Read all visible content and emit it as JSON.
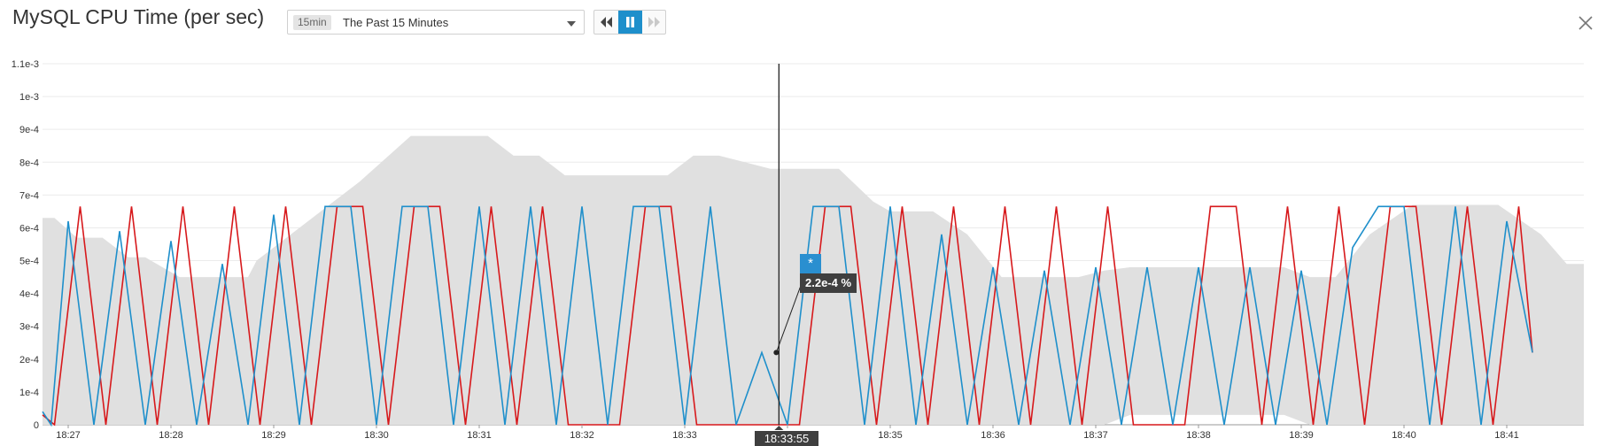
{
  "header": {
    "title": "MySQL CPU Time (per sec)",
    "timeframe_badge": "15min",
    "timeframe_label": "The Past 15 Minutes"
  },
  "controls": {
    "back_icon": "rewind-icon",
    "pause_icon": "pause-icon",
    "forward_icon": "fast-forward-icon",
    "close_icon": "close-icon"
  },
  "colors": {
    "line_primary": "#1e8fcb",
    "line_red": "#d7191c",
    "band": "#e0e0e0",
    "accent": "#1e8fcb"
  },
  "hover": {
    "time": "18:33:55",
    "marker": "*",
    "value_label": "2.2e-4 %"
  },
  "chart_data": {
    "type": "line",
    "title": "MySQL CPU Time (per sec)",
    "xlabel": "",
    "ylabel": "",
    "x_domain": [
      "18:26:45",
      "18:41:45"
    ],
    "ylim": [
      0,
      0.0011
    ],
    "y_ticks": [
      0,
      0.0001,
      0.0002,
      0.0003,
      0.0004,
      0.0005,
      0.0006,
      0.0007,
      0.0008,
      0.0009,
      0.001,
      0.0011
    ],
    "y_tick_labels": [
      "0",
      "1e-4",
      "2e-4",
      "3e-4",
      "4e-4",
      "5e-4",
      "6e-4",
      "7e-4",
      "8e-4",
      "9e-4",
      "1e-3",
      "1.1e-3"
    ],
    "x_ticks": [
      "18:27",
      "18:28",
      "18:29",
      "18:30",
      "18:31",
      "18:32",
      "18:33",
      "18:34",
      "18:35",
      "18:36",
      "18:37",
      "18:38",
      "18:39",
      "18:40",
      "18:41"
    ],
    "x_tick_labels": [
      "18:27",
      "18:28",
      "18:29",
      "18:30",
      "18:31",
      "18:32",
      "18:33",
      "",
      "18:35",
      "18:36",
      "18:37",
      "18:38",
      "18:39",
      "18:40",
      "18:41"
    ],
    "grid": "horizontal",
    "band": {
      "x": [
        "18:26:45",
        "18:26:52",
        "18:27:05",
        "18:27:20",
        "18:27:35",
        "18:27:45",
        "18:28:05",
        "18:28:10",
        "18:28:45",
        "18:28:50",
        "18:29:20",
        "18:29:50",
        "18:30:20",
        "18:30:50",
        "18:31:05",
        "18:31:20",
        "18:31:35",
        "18:31:50",
        "18:32:50",
        "18:33:05",
        "18:33:20",
        "18:33:35",
        "18:33:50",
        "18:34:30",
        "18:34:50",
        "18:35:00",
        "18:35:25",
        "18:35:45",
        "18:36:05",
        "18:36:35",
        "18:36:50",
        "18:37:05",
        "18:37:20",
        "18:37:50",
        "18:38:10",
        "18:38:50",
        "18:39:05",
        "18:39:20",
        "18:39:40",
        "18:40:05",
        "18:40:40",
        "18:40:55",
        "18:41:20",
        "18:41:35",
        "18:41:45"
      ],
      "upper": [
        0.00063,
        0.00063,
        0.00057,
        0.00057,
        0.00051,
        0.00051,
        0.00045,
        0.00045,
        0.00045,
        0.0005,
        0.00062,
        0.00074,
        0.00088,
        0.00088,
        0.00088,
        0.00082,
        0.00082,
        0.00076,
        0.00076,
        0.00082,
        0.00082,
        0.0008,
        0.00078,
        0.00078,
        0.00068,
        0.00065,
        0.00065,
        0.00058,
        0.00045,
        0.00045,
        0.00045,
        0.00047,
        0.00048,
        0.00048,
        0.00048,
        0.00048,
        0.00045,
        0.00045,
        0.00058,
        0.00067,
        0.00067,
        0.00067,
        0.00058,
        0.00049,
        0.00049
      ],
      "lower": [
        0,
        0,
        0,
        0,
        0,
        0,
        0,
        0,
        0,
        0,
        0,
        0,
        0,
        0,
        0,
        0,
        0,
        0,
        0,
        0,
        0,
        0,
        0,
        0,
        0,
        0,
        0,
        0,
        0,
        0,
        0,
        0,
        3e-05,
        3e-05,
        3e-05,
        3e-05,
        0,
        0,
        0,
        0,
        0,
        0,
        0,
        0,
        0
      ]
    },
    "series": [
      {
        "color": "#1e8fcb",
        "x": [
          "18:26:45",
          "18:26:50",
          "18:27:00",
          "18:27:15",
          "18:27:30",
          "18:27:45",
          "18:28:00",
          "18:28:15",
          "18:28:30",
          "18:28:45",
          "18:29:00",
          "18:29:15",
          "18:29:30",
          "18:29:45",
          "18:30:00",
          "18:30:15",
          "18:30:30",
          "18:30:45",
          "18:31:00",
          "18:31:15",
          "18:31:30",
          "18:31:45",
          "18:32:00",
          "18:32:15",
          "18:32:30",
          "18:32:45",
          "18:33:00",
          "18:33:15",
          "18:33:30",
          "18:33:45",
          "18:34:00",
          "18:34:15",
          "18:34:30",
          "18:34:45",
          "18:35:00",
          "18:35:15",
          "18:35:30",
          "18:35:45",
          "18:36:00",
          "18:36:15",
          "18:36:30",
          "18:36:45",
          "18:37:00",
          "18:37:15",
          "18:37:30",
          "18:37:45",
          "18:38:00",
          "18:38:15",
          "18:38:30",
          "18:38:45",
          "18:39:00",
          "18:39:15",
          "18:39:30",
          "18:39:45",
          "18:40:00",
          "18:40:15",
          "18:40:30",
          "18:40:45",
          "18:41:00",
          "18:41:15"
        ],
        "values": [
          4e-05,
          0,
          0.00062,
          0,
          0.00059,
          0,
          0.00056,
          0,
          0.00049,
          0,
          0.00064,
          0,
          0.000665,
          0.000665,
          0,
          0.000665,
          0.000665,
          0,
          0.000665,
          0,
          0.000665,
          0,
          0.000665,
          0,
          0.000665,
          0.000665,
          0,
          0.000665,
          0,
          0.00022,
          0,
          0.000665,
          0.000665,
          0,
          0.000665,
          0,
          0.00058,
          0,
          0.00048,
          0,
          0.00047,
          0,
          0.00048,
          0,
          0.00048,
          0,
          0.00048,
          0,
          0.00048,
          0,
          0.00047,
          0,
          0.00054,
          0.000665,
          0.000665,
          0,
          0.000665,
          0,
          0.00062,
          0.00022
        ]
      },
      {
        "color": "#d7191c",
        "x": [
          "18:26:45",
          "18:26:52",
          "18:27:07",
          "18:27:22",
          "18:27:37",
          "18:27:52",
          "18:28:07",
          "18:28:22",
          "18:28:37",
          "18:28:52",
          "18:29:07",
          "18:29:22",
          "18:29:37",
          "18:29:52",
          "18:30:07",
          "18:30:22",
          "18:30:37",
          "18:30:52",
          "18:31:07",
          "18:31:22",
          "18:31:37",
          "18:31:52",
          "18:32:07",
          "18:32:22",
          "18:32:37",
          "18:32:52",
          "18:33:07",
          "18:33:22",
          "18:33:37",
          "18:33:52",
          "18:34:07",
          "18:34:22",
          "18:34:37",
          "18:34:52",
          "18:35:07",
          "18:35:22",
          "18:35:37",
          "18:35:52",
          "18:36:07",
          "18:36:22",
          "18:36:37",
          "18:36:52",
          "18:37:07",
          "18:37:22",
          "18:37:37",
          "18:37:52",
          "18:38:07",
          "18:38:22",
          "18:38:37",
          "18:38:52",
          "18:39:07",
          "18:39:22",
          "18:39:37",
          "18:39:52",
          "18:40:07",
          "18:40:22",
          "18:40:37",
          "18:40:52",
          "18:41:07",
          "18:41:15"
        ],
        "values": [
          3e-05,
          0,
          0.000665,
          0,
          0.000665,
          0,
          0.000665,
          0,
          0.000665,
          0,
          0.000665,
          0,
          0.000665,
          0.000665,
          0,
          0.000665,
          0.000665,
          0,
          0.000665,
          0,
          0.000665,
          0,
          0,
          0,
          0.000665,
          0.000665,
          0,
          0,
          0,
          0,
          0,
          0.000665,
          0.000665,
          0,
          0.000665,
          0,
          0.000665,
          0,
          0.000665,
          0,
          0.000665,
          0,
          0.000665,
          0,
          0,
          0,
          0.000665,
          0.000665,
          0,
          0.000665,
          0,
          0.000665,
          0,
          0.000665,
          0.000665,
          0,
          0.000665,
          0,
          0.000665,
          0.00022
        ]
      }
    ]
  }
}
